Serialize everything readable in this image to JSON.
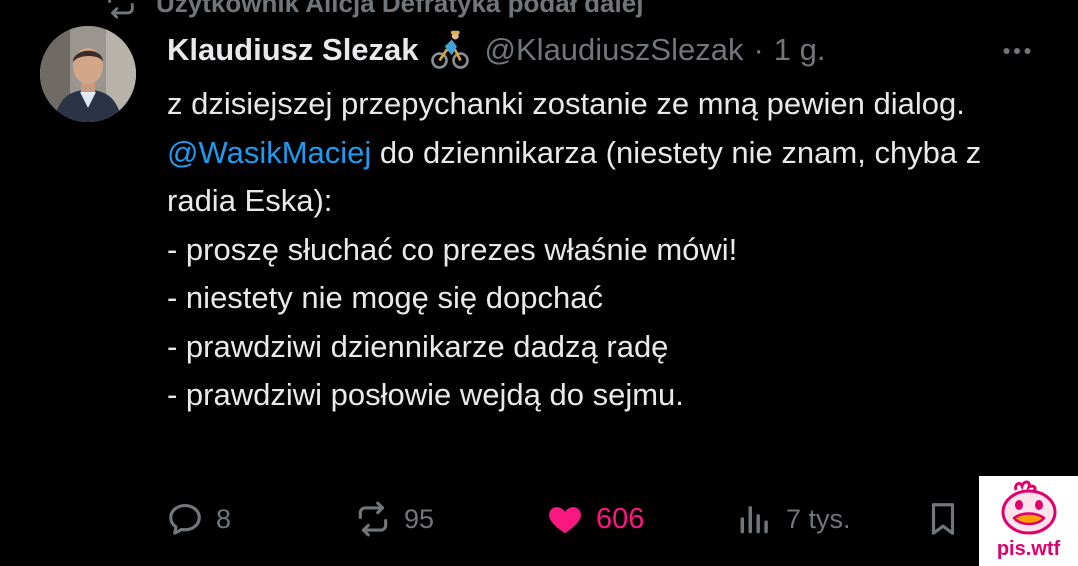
{
  "repost": {
    "text": "Użytkownik Alicja Defratyka podał dalej",
    "icon": "repost-icon"
  },
  "author": {
    "name": "Klaudiusz Slezak",
    "badge_icon": "cyclist-icon",
    "handle": "@KlaudiuszSlezak",
    "separator": "·",
    "time": "1 g."
  },
  "more_icon": "more-dots-icon",
  "tweet": {
    "line1": "z dzisiejszej przepychanki zostanie ze mną pewien dialog.",
    "mention": "@WasikMaciej",
    "line2_rest": " do dziennikarza (niestety nie znam, chyba z radia Eska):",
    "line3": "- proszę słuchać co prezes właśnie mówi!",
    "line4": "- niestety nie mogę się dopchać",
    "line5": "- prawdziwi dziennikarze dadzą radę",
    "line6": "- prawdziwi posłowie wejdą do sejmu."
  },
  "actions": {
    "replies": "8",
    "reposts": "95",
    "likes": "606",
    "views": "7 tys."
  },
  "colors": {
    "background": "#000000",
    "text": "#e7e9ea",
    "muted": "#71767b",
    "mention": "#1d9bf0",
    "like": "#f91880"
  },
  "watermark": {
    "text": "pis.wtf"
  }
}
